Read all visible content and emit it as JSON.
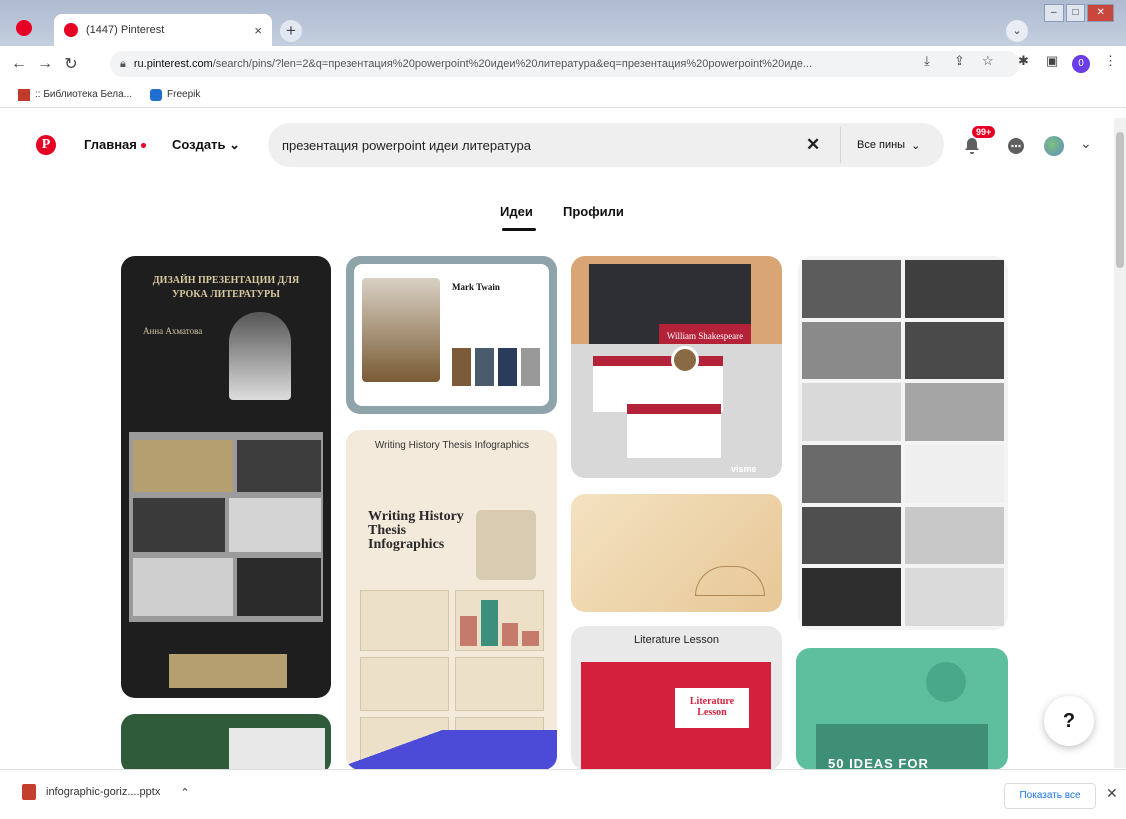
{
  "browser": {
    "tab_title": "(1447) Pinterest",
    "tab_close": "×",
    "new_tab": "+",
    "url_host": "ru.pinterest.com",
    "url_rest": "/search/pins/?len=2&q=презентация%20powerpoint%20идеи%20литература&eq=презентация%20powerpoint%20иде...",
    "profile_letter": "0"
  },
  "bookmarks": [
    {
      "label": ":: Библиотека Бела..."
    },
    {
      "label": "Freepik"
    }
  ],
  "header": {
    "home_label": "Главная",
    "create_label": "Создать",
    "search_value": "презентация powerpoint идеи литература",
    "filter_label": "Все пины",
    "notification_count": "99+"
  },
  "tabs": {
    "ideas": "Идеи",
    "profiles": "Профили"
  },
  "pins": {
    "pin1_title": "ДИЗАЙН ПРЕЗЕНТАЦИИ ДЛЯ УРОКА ЛИТЕРАТУРЫ",
    "pin1_subtitle": "Анна Ахматова",
    "pin2_name": "Mark Twain",
    "pin3_caption": "William Shakespeare",
    "pin3_brand": "visme",
    "pin4_title": "Writing History Thesis Infographics",
    "pin4_inner_title": "Writing History Thesis Infographics",
    "pin6_title": "Literature Lesson",
    "pin6_slide": "Literature Lesson",
    "pin7_text": "50 IDEAS FOR"
  },
  "help_label": "?",
  "downloads": {
    "file_name": "infographic-goriz....pptx",
    "show_all": "Показать все"
  },
  "colors": {
    "pinterest_red": "#e60023",
    "link_blue": "#1a73e8"
  }
}
